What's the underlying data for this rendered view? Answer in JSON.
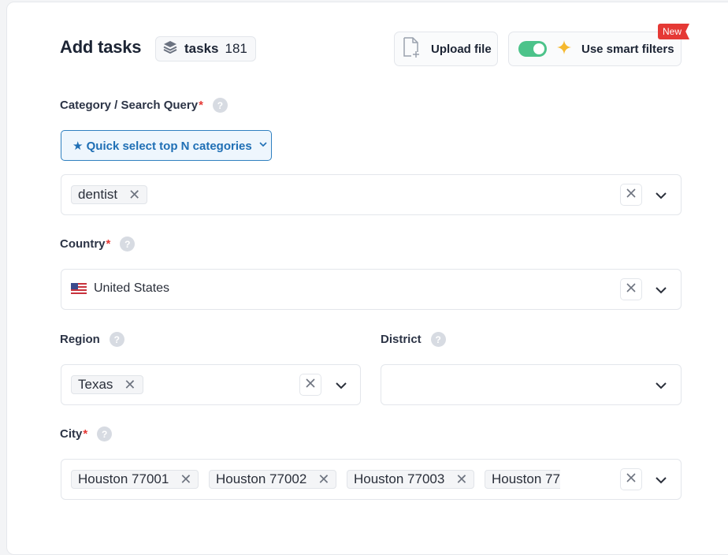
{
  "header": {
    "title": "Add tasks",
    "tasks_label": "tasks",
    "tasks_count": "181",
    "upload_label": "Upload file",
    "smart_filters_label": "Use smart filters",
    "smart_filters_enabled": true,
    "new_badge": "New"
  },
  "category": {
    "label": "Category / Search Query",
    "required_mark": "*",
    "quick_select_label": "★ Quick select top N categories",
    "chips": [
      "dentist"
    ]
  },
  "country": {
    "label": "Country",
    "required_mark": "*",
    "selected": "United States"
  },
  "region": {
    "label": "Region",
    "chips": [
      "Texas"
    ]
  },
  "district": {
    "label": "District"
  },
  "city": {
    "label": "City",
    "required_mark": "*",
    "chips": [
      "Houston 77001",
      "Houston 77002",
      "Houston 77003",
      "Houston 77"
    ]
  },
  "icons": {
    "help": "?",
    "remove": "✕"
  },
  "colors": {
    "accent": "#1f6fb5",
    "toggle_on": "#4cc38a",
    "required": "#e53935",
    "new_badge": "#e53935"
  }
}
